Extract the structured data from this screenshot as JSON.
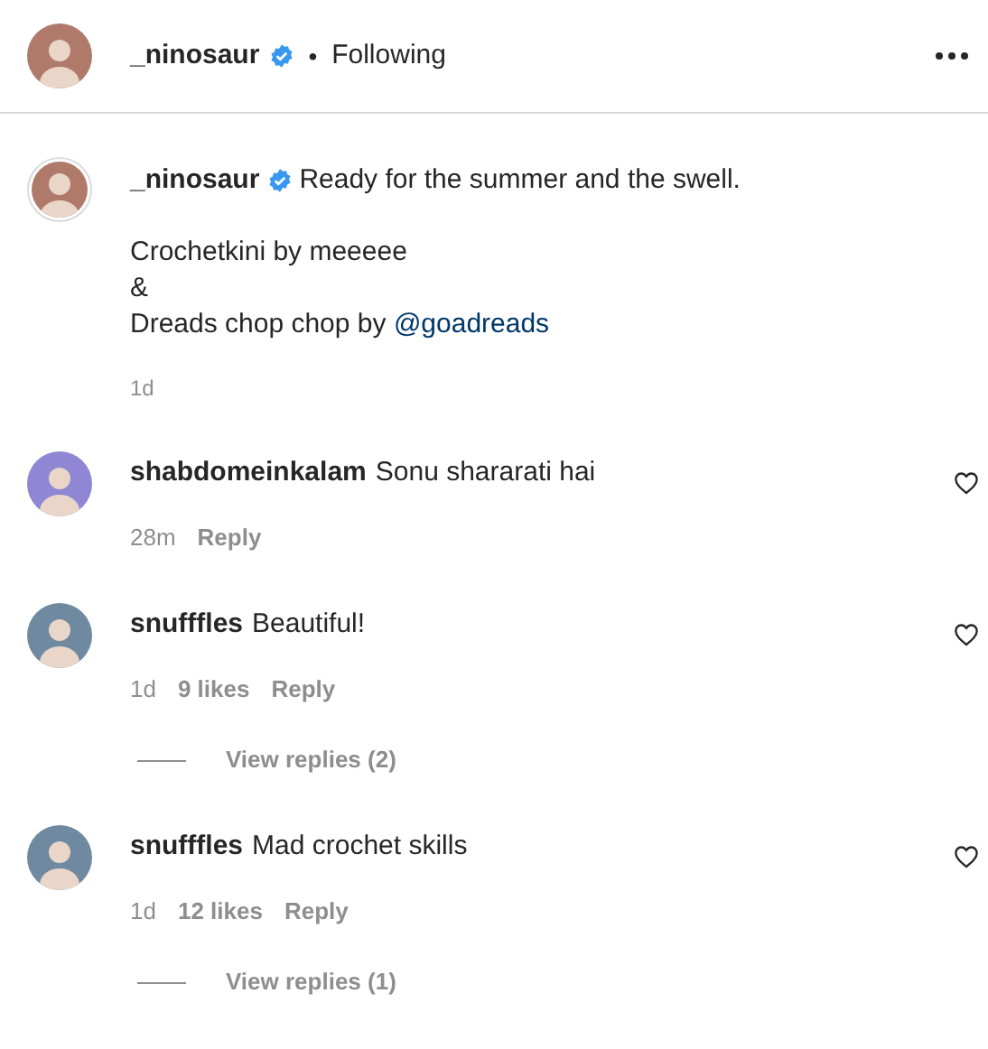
{
  "header": {
    "username": "_ninosaur",
    "verified": true,
    "separator": "•",
    "follow_status": "Following"
  },
  "caption": {
    "username": "_ninosaur",
    "verified": true,
    "text": "Ready for the summer and the swell.",
    "body_lines": [
      "Crochetkini by meeeee",
      "&",
      "Dreads chop chop by"
    ],
    "mention": "@goadreads",
    "time": "1d"
  },
  "comments": [
    {
      "username": "shabdomeinkalam",
      "text": "Sonu shararati hai",
      "color": "#8f86d4",
      "time": "28m",
      "reply": "Reply",
      "liked": false
    },
    {
      "username": "snufffles",
      "text": "Beautiful!",
      "color": "#6f8aa0",
      "time": "1d",
      "likes": "9 likes",
      "reply": "Reply",
      "liked": false,
      "view_replies": "View replies (2)"
    },
    {
      "username": "snufffles",
      "text": "Mad crochet skills",
      "color": "#6f8aa0",
      "time": "1d",
      "likes": "12 likes",
      "reply": "Reply",
      "liked": false,
      "view_replies": "View replies (1)"
    }
  ]
}
